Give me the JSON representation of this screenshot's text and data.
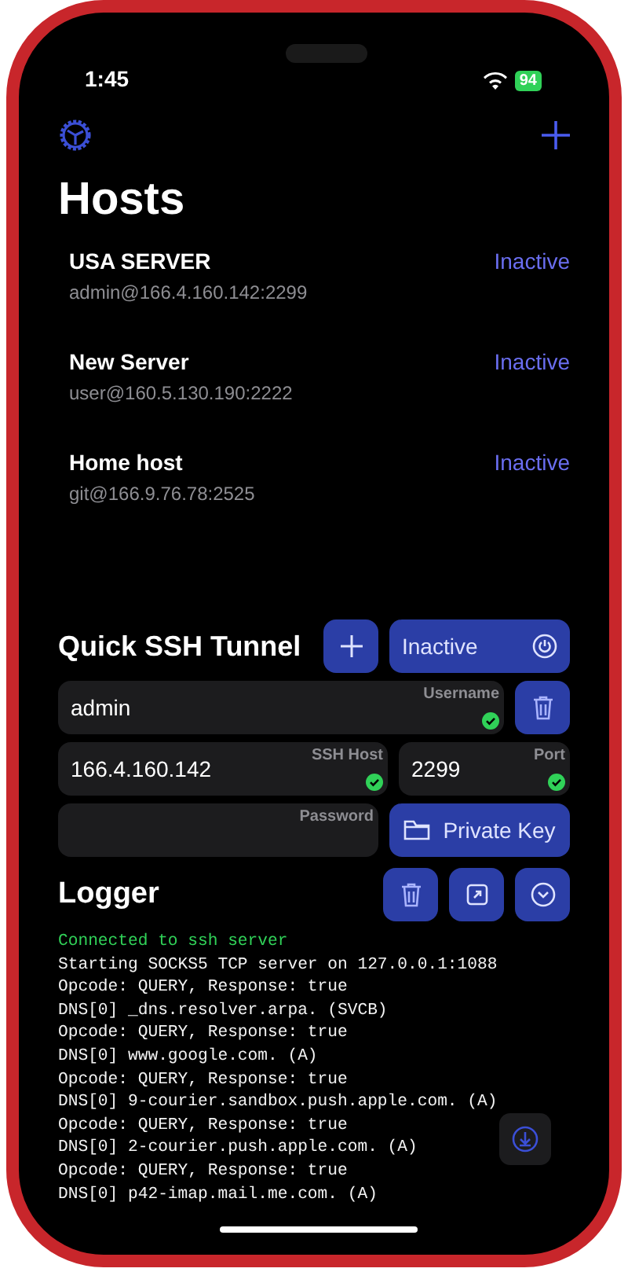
{
  "status_bar": {
    "time": "1:45",
    "battery": "94"
  },
  "title": "Hosts",
  "hosts": [
    {
      "name": "USA SERVER",
      "address": "admin@166.4.160.142:2299",
      "status": "Inactive"
    },
    {
      "name": "New Server",
      "address": "user@160.5.130.190:2222",
      "status": "Inactive"
    },
    {
      "name": "Home host",
      "address": "git@166.9.76.78:2525",
      "status": "Inactive"
    }
  ],
  "quick_tunnel": {
    "title": "Quick SSH Tunnel",
    "toggle_label": "Inactive",
    "private_key_label": "Private Key",
    "fields": [
      {
        "label": "Username",
        "value": "admin",
        "valid": true
      },
      {
        "label": "SSH Host",
        "value": "166.4.160.142",
        "valid": true
      },
      {
        "label": "Port",
        "value": "2299",
        "valid": true
      },
      {
        "label": "Password",
        "valid": false
      }
    ]
  },
  "logger": {
    "title": "Logger",
    "lines": [
      {
        "kind": "success",
        "text": "Connected to ssh server"
      },
      {
        "kind": "info",
        "text": "Starting SOCKS5 TCP server on 127.0.0.1:1088"
      },
      {
        "kind": "info",
        "text": "Opcode: QUERY, Response: true"
      },
      {
        "kind": "info",
        "text": "DNS[0] _dns.resolver.arpa. (SVCB)"
      },
      {
        "kind": "info",
        "text": "Opcode: QUERY, Response: true"
      },
      {
        "kind": "info",
        "text": "DNS[0] www.google.com. (A)"
      },
      {
        "kind": "info",
        "text": "Opcode: QUERY, Response: true"
      },
      {
        "kind": "info",
        "text": "DNS[0] 9-courier.sandbox.push.apple.com. (A)"
      },
      {
        "kind": "info",
        "text": "Opcode: QUERY, Response: true"
      },
      {
        "kind": "info",
        "text": "DNS[0] 2-courier.push.apple.com. (A)"
      },
      {
        "kind": "info",
        "text": "Opcode: QUERY, Response: true"
      },
      {
        "kind": "info",
        "text": "DNS[0] p42-imap.mail.me.com. (A)"
      }
    ]
  }
}
